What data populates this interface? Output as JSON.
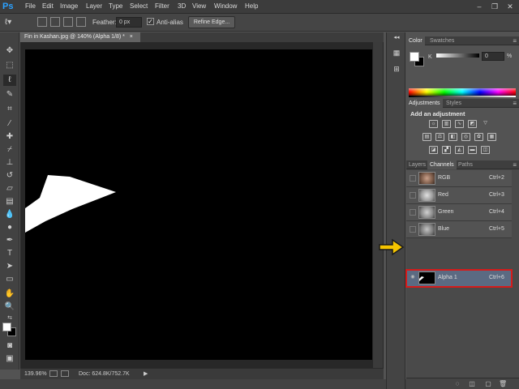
{
  "app": {
    "logo": "Ps"
  },
  "menu": [
    "File",
    "Edit",
    "Image",
    "Layer",
    "Type",
    "Select",
    "Filter",
    "3D",
    "View",
    "Window",
    "Help"
  ],
  "window_controls": {
    "minimize": "–",
    "restore": "❐",
    "close": "✕"
  },
  "options_bar": {
    "feather_label": "Feather:",
    "feather_value": "0 px",
    "antialias_label": "Anti-alias",
    "antialias_checked": "✓",
    "refine_edge_label": "Refine Edge..."
  },
  "document": {
    "tab_title": "Fin in Kashan.jpg @ 140% (Alpha 1/8) *",
    "tab_close": "×",
    "zoom": "139.96%",
    "doc_info": "Doc: 624.8K/752.7K",
    "status_arrow": "▶"
  },
  "color_panel": {
    "tabs": [
      "Color",
      "Swatches"
    ],
    "k_label": "K",
    "k_value": "0",
    "k_unit": "%"
  },
  "adjustments_panel": {
    "tabs": [
      "Adjustments",
      "Styles"
    ],
    "title": "Add an adjustment"
  },
  "channels_panel": {
    "tabs": [
      "Layers",
      "Channels",
      "Paths"
    ],
    "rows": [
      {
        "name": "RGB",
        "shortcut": "Ctrl+2"
      },
      {
        "name": "Red",
        "shortcut": "Ctrl+3"
      },
      {
        "name": "Green",
        "shortcut": "Ctrl+4"
      },
      {
        "name": "Blue",
        "shortcut": "Ctrl+5"
      },
      {
        "name": "Alpha 1",
        "shortcut": "Ctrl+6"
      }
    ],
    "selected_row": "Alpha 1"
  },
  "colors": {
    "accent_logo": "#2ba1ff",
    "selection_highlight": "#d61b1b",
    "callout_arrow": "#f5c400"
  }
}
